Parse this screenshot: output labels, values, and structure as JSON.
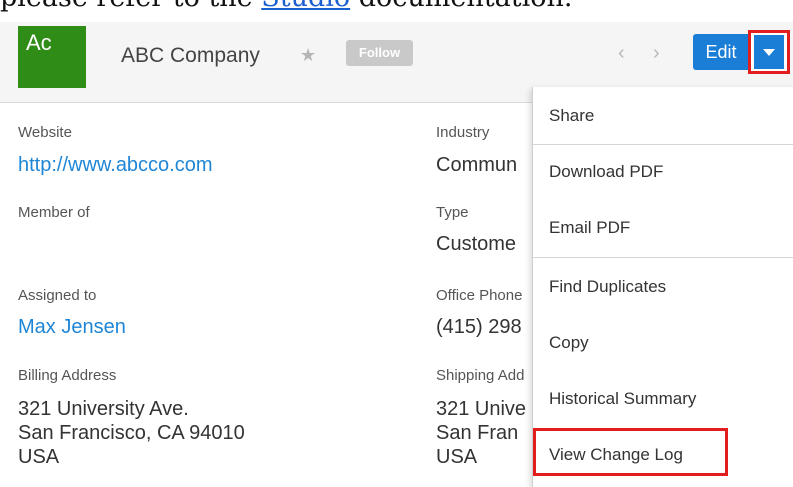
{
  "doc_text": {
    "prefix": "please refer to the ",
    "link": "Studio",
    "suffix": " documentation."
  },
  "header": {
    "avatar_text": "Ac",
    "company_name": "ABC Company",
    "star_icon": "star-icon",
    "follow_label": "Follow",
    "prev_icon": "chevron-left-icon",
    "next_icon": "chevron-right-icon",
    "edit_label": "Edit",
    "actions_icon": "caret-down-icon"
  },
  "record": {
    "website_label": "Website",
    "website_value": "http://www.abcco.com",
    "industry_label": "Industry",
    "industry_value": "Commun",
    "member_label": "Member of",
    "type_label": "Type",
    "type_value": "Custome",
    "assigned_label": "Assigned to",
    "assigned_value": "Max Jensen",
    "office_phone_label": "Office Phone",
    "office_phone_value": "(415) 298",
    "billing_label": "Billing Address",
    "billing_line1": "321 University Ave.",
    "billing_line2": "San Francisco, CA 94010",
    "billing_line3": "USA",
    "shipping_label": "Shipping Add",
    "shipping_line1": "321 Unive",
    "shipping_line2": "San Fran",
    "shipping_line3": "USA"
  },
  "dropdown": {
    "items": [
      "Share",
      "Download PDF",
      "Email PDF",
      "Find Duplicates",
      "Copy",
      "Historical Summary",
      "View Change Log"
    ]
  },
  "colors": {
    "avatar": "#2f8c17",
    "primary_button": "#1a7dd6",
    "link": "#1f86d6",
    "highlight": "#e11d1d"
  }
}
